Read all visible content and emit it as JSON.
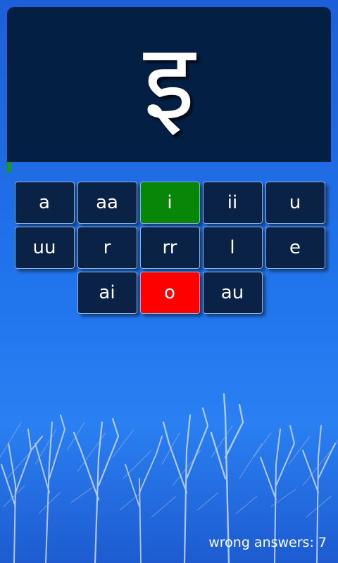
{
  "prompt": {
    "glyph": "इ"
  },
  "timer": {
    "remaining_fraction": 0.01,
    "color": "#1a9a16"
  },
  "answers": [
    {
      "label": "a",
      "state": "normal"
    },
    {
      "label": "aa",
      "state": "normal"
    },
    {
      "label": "i",
      "state": "correct"
    },
    {
      "label": "ii",
      "state": "normal"
    },
    {
      "label": "u",
      "state": "normal"
    },
    {
      "label": "uu",
      "state": "normal"
    },
    {
      "label": "r",
      "state": "normal"
    },
    {
      "label": "rr",
      "state": "normal"
    },
    {
      "label": "l",
      "state": "normal"
    },
    {
      "label": "e",
      "state": "normal"
    },
    {
      "label": "ai",
      "state": "normal"
    },
    {
      "label": "o",
      "state": "wrong"
    },
    {
      "label": "au",
      "state": "normal"
    }
  ],
  "status": {
    "wrong_answers_text": "wrong answers: 7"
  },
  "colors": {
    "card": "#041f44",
    "key": "#0b2247",
    "correct": "#078607",
    "wrong": "#fe0000"
  }
}
